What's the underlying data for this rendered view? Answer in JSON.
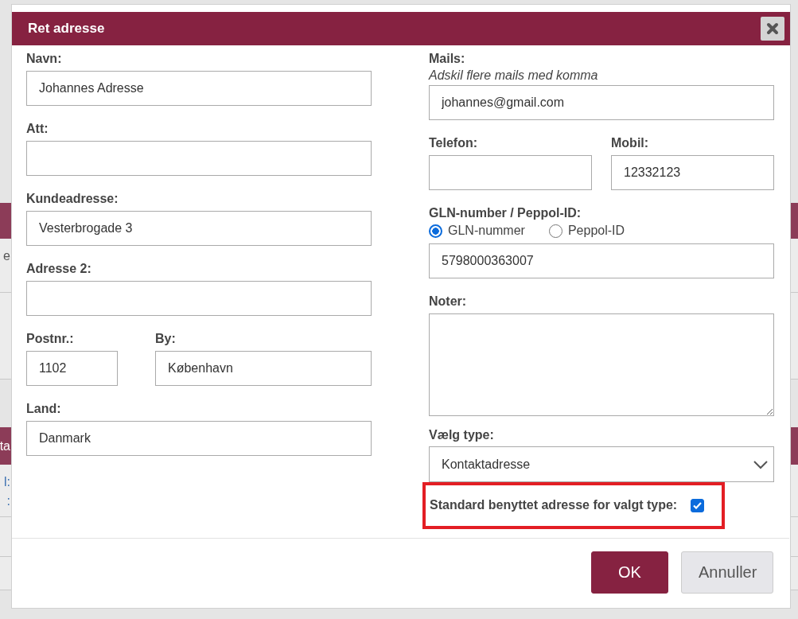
{
  "background": {
    "rows": [
      {
        "kind": "space"
      },
      {
        "kind": "bar"
      },
      {
        "kind": "line",
        "texts": [
          "e"
        ]
      },
      {
        "kind": "line"
      },
      {
        "kind": "space"
      },
      {
        "kind": "bar",
        "texts": [
          "ta"
        ]
      },
      {
        "kind": "line",
        "texts": [
          "l:",
          ":"
        ]
      },
      {
        "kind": "line"
      },
      {
        "kind": "line"
      }
    ]
  },
  "dialog": {
    "title": "Ret adresse",
    "left_column": [
      {
        "kind": "field",
        "label": "Navn:",
        "value": "Johannes Adresse"
      },
      {
        "kind": "field",
        "label": "Att:"
      },
      {
        "kind": "field",
        "label": "Kundeadresse:",
        "value": "Vesterbrogade 3"
      },
      {
        "kind": "field",
        "label": "Adresse 2:"
      },
      {
        "kind": "pair",
        "fields": [
          {
            "label": "Postnr.:",
            "value": "1102"
          },
          {
            "label": "By:",
            "value": "København"
          }
        ]
      },
      {
        "kind": "field",
        "label": "Land:",
        "value": "Danmark"
      }
    ],
    "right_column": [
      {
        "kind": "field",
        "label": "Mails:",
        "hint": "Adskil flere mails med komma",
        "value": "johannes@gmail.com"
      },
      {
        "kind": "pair",
        "fields": [
          {
            "label": "Telefon:"
          },
          {
            "label": "Mobil:",
            "value": "12332123"
          }
        ]
      },
      {
        "kind": "radio_field",
        "label": "GLN-number / Peppol-ID:",
        "options": [
          {
            "label": "GLN-nummer",
            "selected": true
          },
          {
            "label": "Peppol-ID",
            "selected": false
          }
        ],
        "value": "5798000363007"
      },
      {
        "kind": "textarea",
        "label": "Noter:"
      },
      {
        "kind": "select",
        "label": "Vælg type:",
        "value": "Kontaktadresse"
      },
      {
        "kind": "checkbox",
        "label": "Standard benyttet adresse for valgt type:",
        "checked": true,
        "highlighted": true
      }
    ],
    "buttons": [
      {
        "label": "OK",
        "kind": "primary"
      },
      {
        "label": "Annuller",
        "kind": "secondary"
      }
    ]
  }
}
